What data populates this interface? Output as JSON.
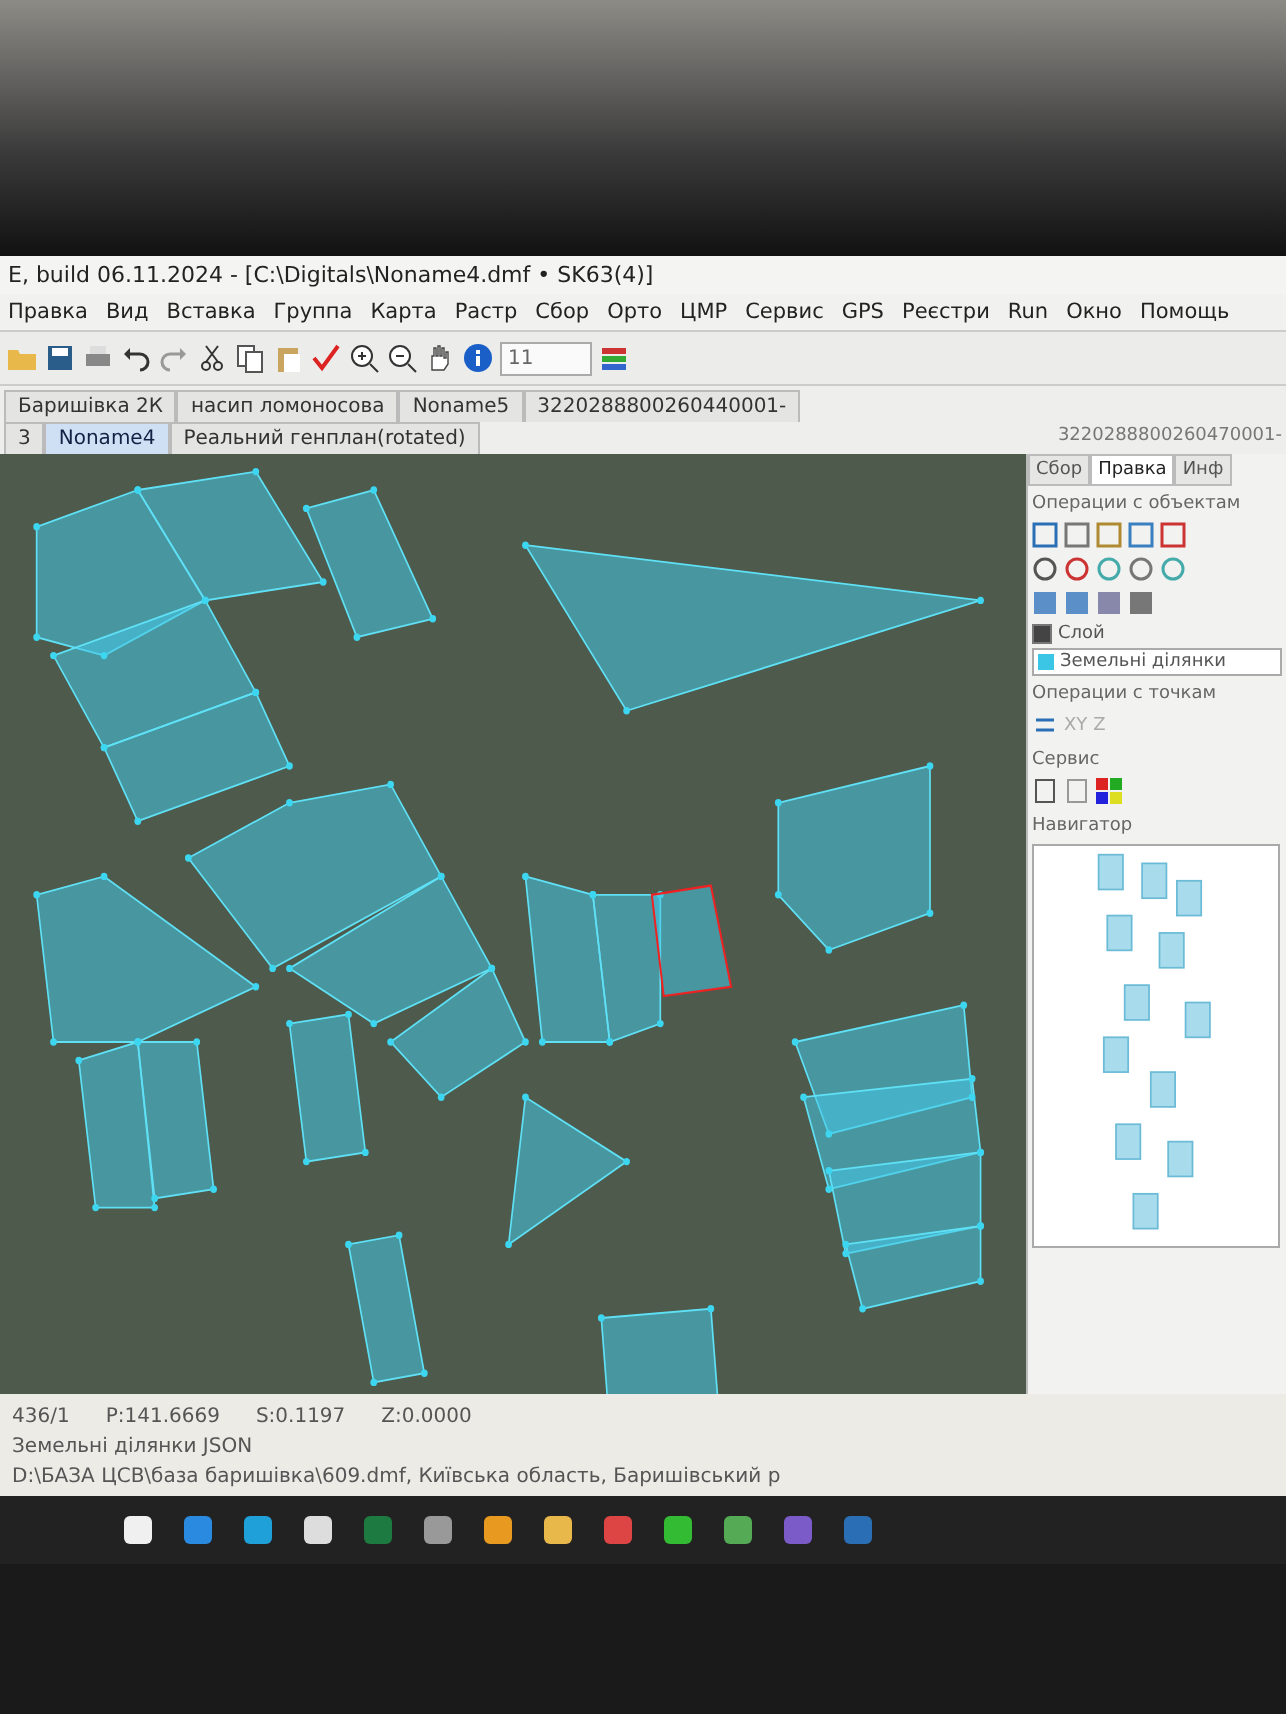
{
  "window": {
    "title": "E, build 06.11.2024 - [C:\\Digitals\\Noname4.dmf • SK63(4)]"
  },
  "menu": [
    {
      "label": "Правка"
    },
    {
      "label": "Вид"
    },
    {
      "label": "Вставка"
    },
    {
      "label": "Группа"
    },
    {
      "label": "Карта"
    },
    {
      "label": "Растр"
    },
    {
      "label": "Сбор"
    },
    {
      "label": "Орто"
    },
    {
      "label": "ЦМР"
    },
    {
      "label": "Сервис"
    },
    {
      "label": "GPS"
    },
    {
      "label": "Реєстри"
    },
    {
      "label": "Run"
    },
    {
      "label": "Окно"
    },
    {
      "label": "Помощь"
    }
  ],
  "toolbar": {
    "scale_value": "11"
  },
  "document_tabs_top": [
    {
      "label": "Баришівка 2К",
      "selected": false
    },
    {
      "label": "насип ломоносова",
      "selected": false
    },
    {
      "label": "Noname5",
      "selected": false
    },
    {
      "label": "3220288800260440001-",
      "selected": false
    }
  ],
  "document_tabs": [
    {
      "label": "3",
      "selected": false
    },
    {
      "label": "Noname4",
      "selected": true
    },
    {
      "label": "Реальний генплан(rotated)",
      "selected": false
    }
  ],
  "side_panel": {
    "header": "3220288800260470001-",
    "tabs": [
      {
        "label": "Сбор",
        "selected": false
      },
      {
        "label": "Правка",
        "selected": true
      },
      {
        "label": "Инф",
        "selected": false
      }
    ],
    "object_ops_title": "Операции с объектам",
    "layer": {
      "label": "Слой",
      "checked": true
    },
    "layer_value": "Земельні ділянки",
    "point_ops_title": "Операции с точкам",
    "point_ops_labels": [
      "XY",
      "Z"
    ],
    "service_title": "Сервис",
    "navigator_title": "Навигатор"
  },
  "status_bar": {
    "fields": [
      "436/1",
      "P:141.6669",
      "S:0.1197",
      "Z:0.0000"
    ],
    "layer": "Земельні ділянки JSON",
    "path": "D:\\БАЗА ЦСВ\\база баришівка\\609.dmf, Київська область, Баришівський р"
  }
}
